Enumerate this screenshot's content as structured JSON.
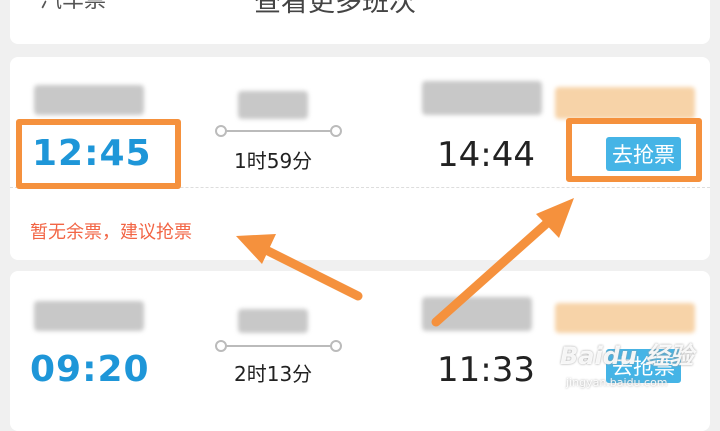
{
  "top": {
    "left_text": "汽车票",
    "more_text": "查看更多班次"
  },
  "trains": [
    {
      "depart": "12:45",
      "duration": "1时59分",
      "arrive": "14:44",
      "action_label": "去抢票",
      "notice": "暂无余票，建议抢票"
    },
    {
      "depart": "09:20",
      "duration": "2时13分",
      "arrive": "11:33",
      "action_label": "去抢票"
    }
  ],
  "watermark": {
    "brand": "Baidu 经验",
    "url": "jingyan.baidu.com"
  },
  "colors": {
    "depart_time": "#1e96d8",
    "button": "#45b4e6",
    "notice": "#f26545",
    "annotation": "#f5913d"
  }
}
